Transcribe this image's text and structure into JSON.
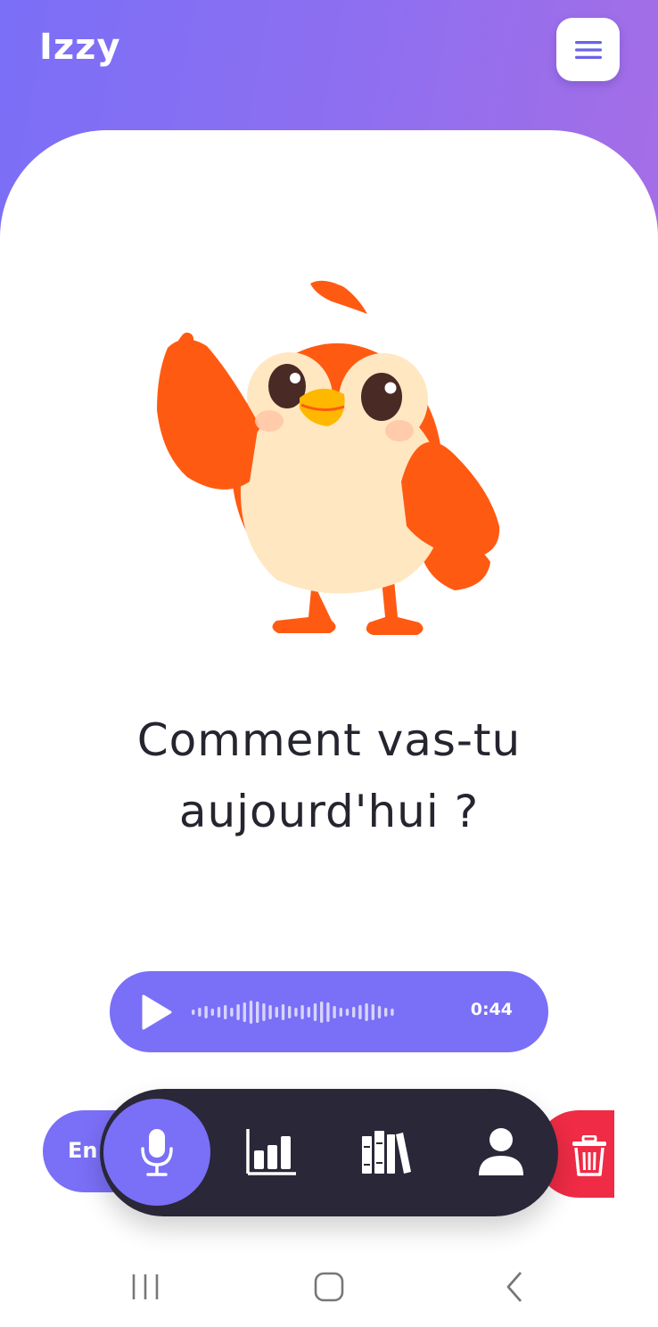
{
  "header": {
    "app_title": "Izzy",
    "menu_icon": "hamburger-menu-icon"
  },
  "main": {
    "mascot": "orange-bird-mascot",
    "question": "Comment vas-tu aujourd'hui ?"
  },
  "audio_player": {
    "play_icon": "play-icon",
    "time": "0:44"
  },
  "actions": {
    "send_label": "En",
    "delete_icon": "trash-icon"
  },
  "bottom_nav": {
    "items": [
      {
        "icon": "microphone-icon",
        "active": true
      },
      {
        "icon": "bar-chart-icon",
        "active": false
      },
      {
        "icon": "library-icon",
        "active": false
      },
      {
        "icon": "user-icon",
        "active": false
      }
    ]
  },
  "system_nav": {
    "items": [
      "recent-apps-icon",
      "home-icon",
      "back-icon"
    ]
  },
  "colors": {
    "accent": "#7a6ff7",
    "nav_dark": "#2a2738",
    "delete": "#ef2b45",
    "mascot_orange": "#ff5a12",
    "mascot_cream": "#ffe7c2"
  }
}
